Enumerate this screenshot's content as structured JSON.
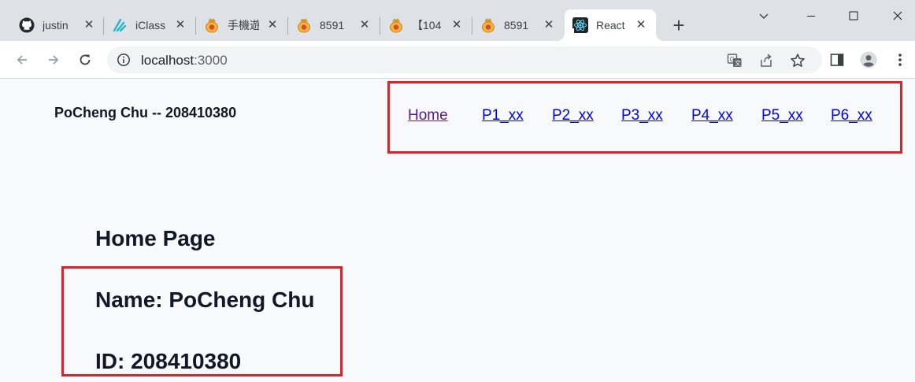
{
  "browser": {
    "tabs": [
      {
        "label": "justin",
        "icon": "github-icon"
      },
      {
        "label": "iClass",
        "icon": "iclass-icon"
      },
      {
        "label": "手機遊",
        "icon": "moneybag-icon"
      },
      {
        "label": "8591",
        "icon": "moneybag-icon"
      },
      {
        "label": "【104",
        "icon": "moneybag-icon"
      },
      {
        "label": "8591",
        "icon": "moneybag-icon"
      },
      {
        "label": "React",
        "icon": "react-icon",
        "active": true
      }
    ],
    "url_host": "localhost",
    "url_port": ":3000",
    "colors": {
      "tabstrip": "#dee1e6",
      "active_tab": "#ffffff",
      "omnibox": "#f1f3f4"
    }
  },
  "header": {
    "brand": "PoCheng Chu -- 208410380",
    "nav_links": [
      "Home",
      "P1_xx",
      "P2_xx",
      "P3_xx",
      "P4_xx",
      "P5_xx",
      "P6_xx"
    ]
  },
  "main": {
    "title": "Home Page",
    "name_line": "Name: PoCheng Chu",
    "id_line": "ID: 208410380"
  },
  "colors": {
    "highlight_border": "#e0212c",
    "link": "#0000ee",
    "link_visited": "#551a8b",
    "page_bg": "#f8f9fb"
  }
}
